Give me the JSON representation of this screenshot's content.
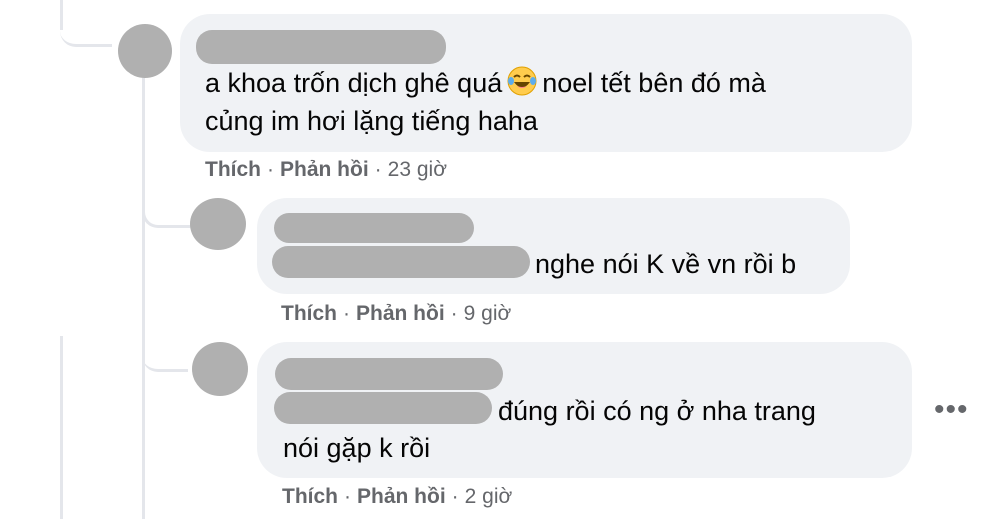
{
  "comments": [
    {
      "text_line1_before": "a khoa trốn dịch ghê quá",
      "emoji_icon": "face-with-tears-of-joy-icon",
      "text_line1_after": "noel tết bên đó mà",
      "text_line2": "củng im hơi lặng tiếng haha",
      "like_label": "Thích",
      "reply_label": "Phản hồi",
      "timestamp": "23 giờ"
    },
    {
      "text_line1": "nghe nói K về vn rồi b",
      "like_label": "Thích",
      "reply_label": "Phản hồi",
      "timestamp": "9 giờ"
    },
    {
      "text_line1": "đúng rồi có ng ở nha trang",
      "text_line2": "nói gặp k rồi",
      "like_label": "Thích",
      "reply_label": "Phản hồi",
      "timestamp": "2 giờ"
    }
  ],
  "separator": "·",
  "more_icon": "more-options-icon",
  "more_label": "•••"
}
